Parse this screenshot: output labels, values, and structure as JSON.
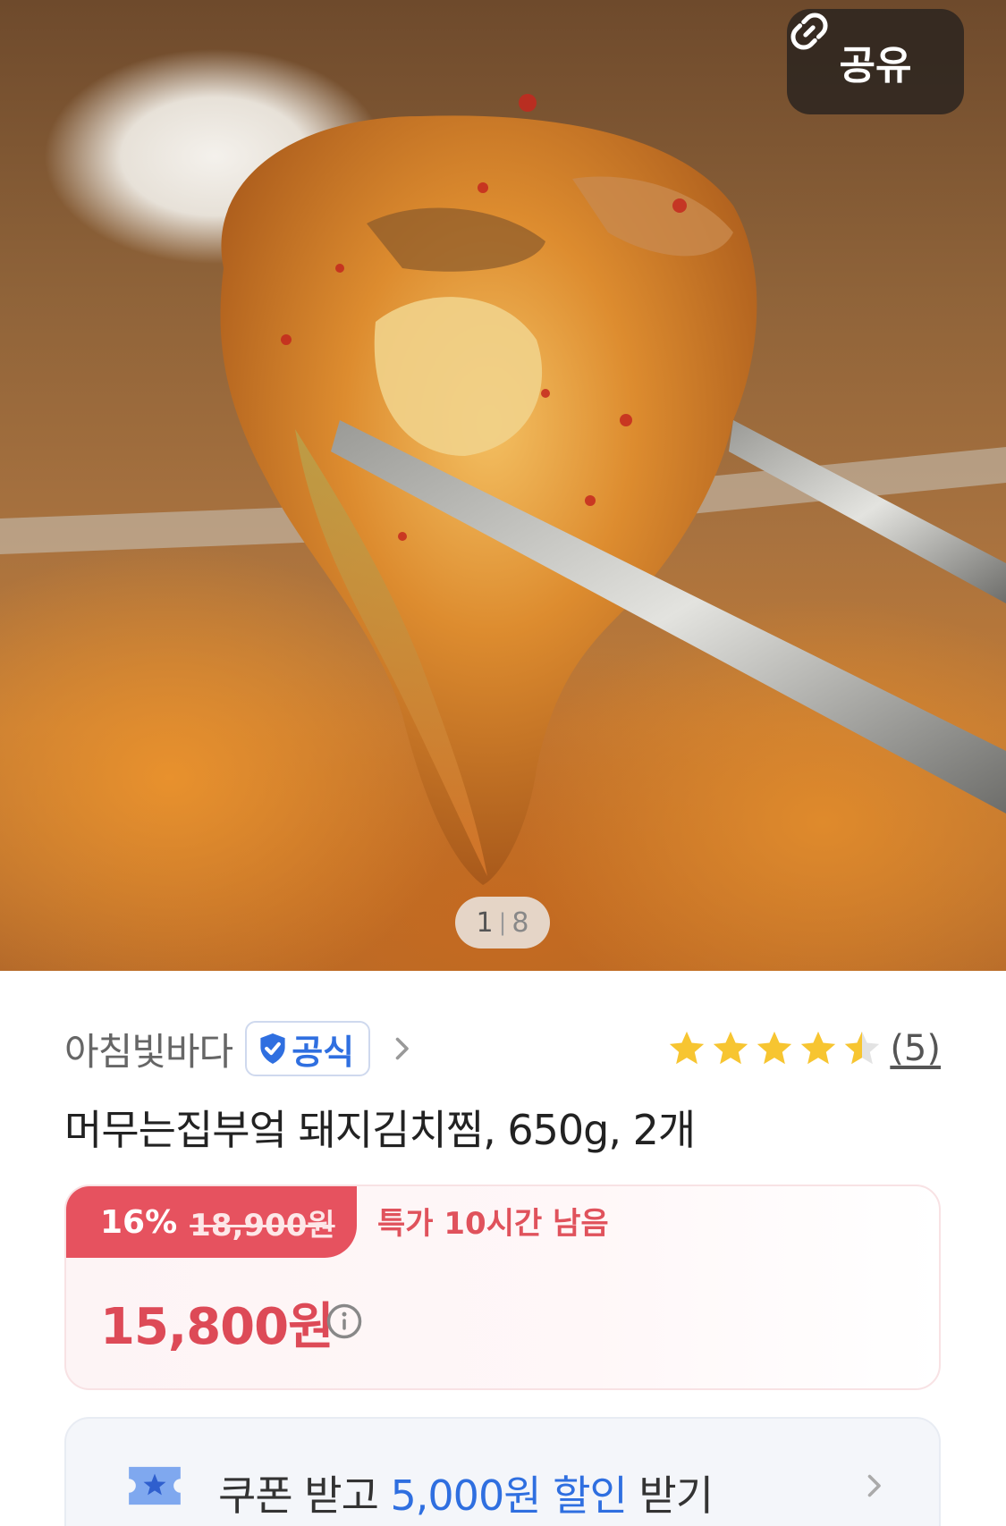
{
  "hero": {
    "share_label": "공유",
    "page_current": "1",
    "page_total": "8"
  },
  "seller": {
    "name": "아침빛바다",
    "badge": "공식"
  },
  "rating": {
    "stars": 4.5,
    "review_count": "(5)"
  },
  "product": {
    "title": "머무는집부엌 돼지김치찜, 650g, 2개"
  },
  "price": {
    "discount_rate": "16%",
    "original_price": "18,900원",
    "timer_text": "특가 10시간 남음",
    "sale_price": "15,800원"
  },
  "coupon": {
    "prefix": "쿠폰 받고 ",
    "amount": "5,000원 할인",
    "suffix": " 받기"
  },
  "colors": {
    "accent_red": "#e6525f",
    "accent_blue": "#2f6fe0",
    "star": "#f7c531"
  }
}
